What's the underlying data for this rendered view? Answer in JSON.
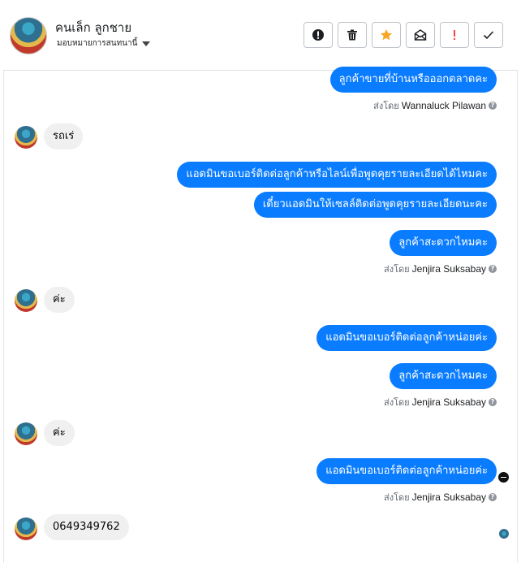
{
  "header": {
    "name": "คนเล็ก ลูกชาย",
    "assign_label": "มอบหมายการสนทนานี้",
    "actions": [
      "report-icon",
      "trash-icon",
      "star-icon",
      "mark-unread-icon",
      "important-icon",
      "done-icon"
    ],
    "star_color": "#f5a623",
    "important_color": "#fa3e3e"
  },
  "messages": [
    {
      "dir": "out",
      "text": "ลูกค้าขายที่บ้านหรือออกตลาดคะ"
    },
    {
      "sent_prefix": "ส่งโดย",
      "sender": "Wannaluck Pilawan"
    },
    {
      "dir": "in",
      "text": "รถเร่"
    },
    {
      "dir": "out",
      "text": "แอดมินขอเบอร์ติดต่อลูกค้าหรือไลน์เพื่อพูดคุยรายละเอียดได้ไหมคะ"
    },
    {
      "dir": "out",
      "text": "เดี๋ยวแอดมินให้เซลล์ติดต่อพูดคุยรายละเอียดนะคะ"
    },
    {
      "dir": "out",
      "text": "ลูกค้าสะดวกไหมคะ"
    },
    {
      "sent_prefix": "ส่งโดย",
      "sender": "Jenjira Suksabay"
    },
    {
      "dir": "in",
      "text": "ค่ะ"
    },
    {
      "dir": "out",
      "text": "แอดมินขอเบอร์ติดต่อลูกค้าหน่อยค่ะ"
    },
    {
      "dir": "out",
      "text": "ลูกค้าสะดวกไหมคะ"
    },
    {
      "sent_prefix": "ส่งโดย",
      "sender": "Jenjira Suksabay"
    },
    {
      "dir": "in",
      "text": "ค่ะ"
    },
    {
      "dir": "out",
      "text": "แอดมินขอเบอร์ติดต่อลูกค้าหน่อยค่ะ"
    },
    {
      "sent_prefix": "ส่งโดย",
      "sender": "Jenjira Suksabay"
    },
    {
      "dir": "in",
      "text": "0649349762"
    }
  ],
  "colors": {
    "outgoing_bubble": "#0a7cff",
    "incoming_bubble": "#f0f0f0"
  }
}
